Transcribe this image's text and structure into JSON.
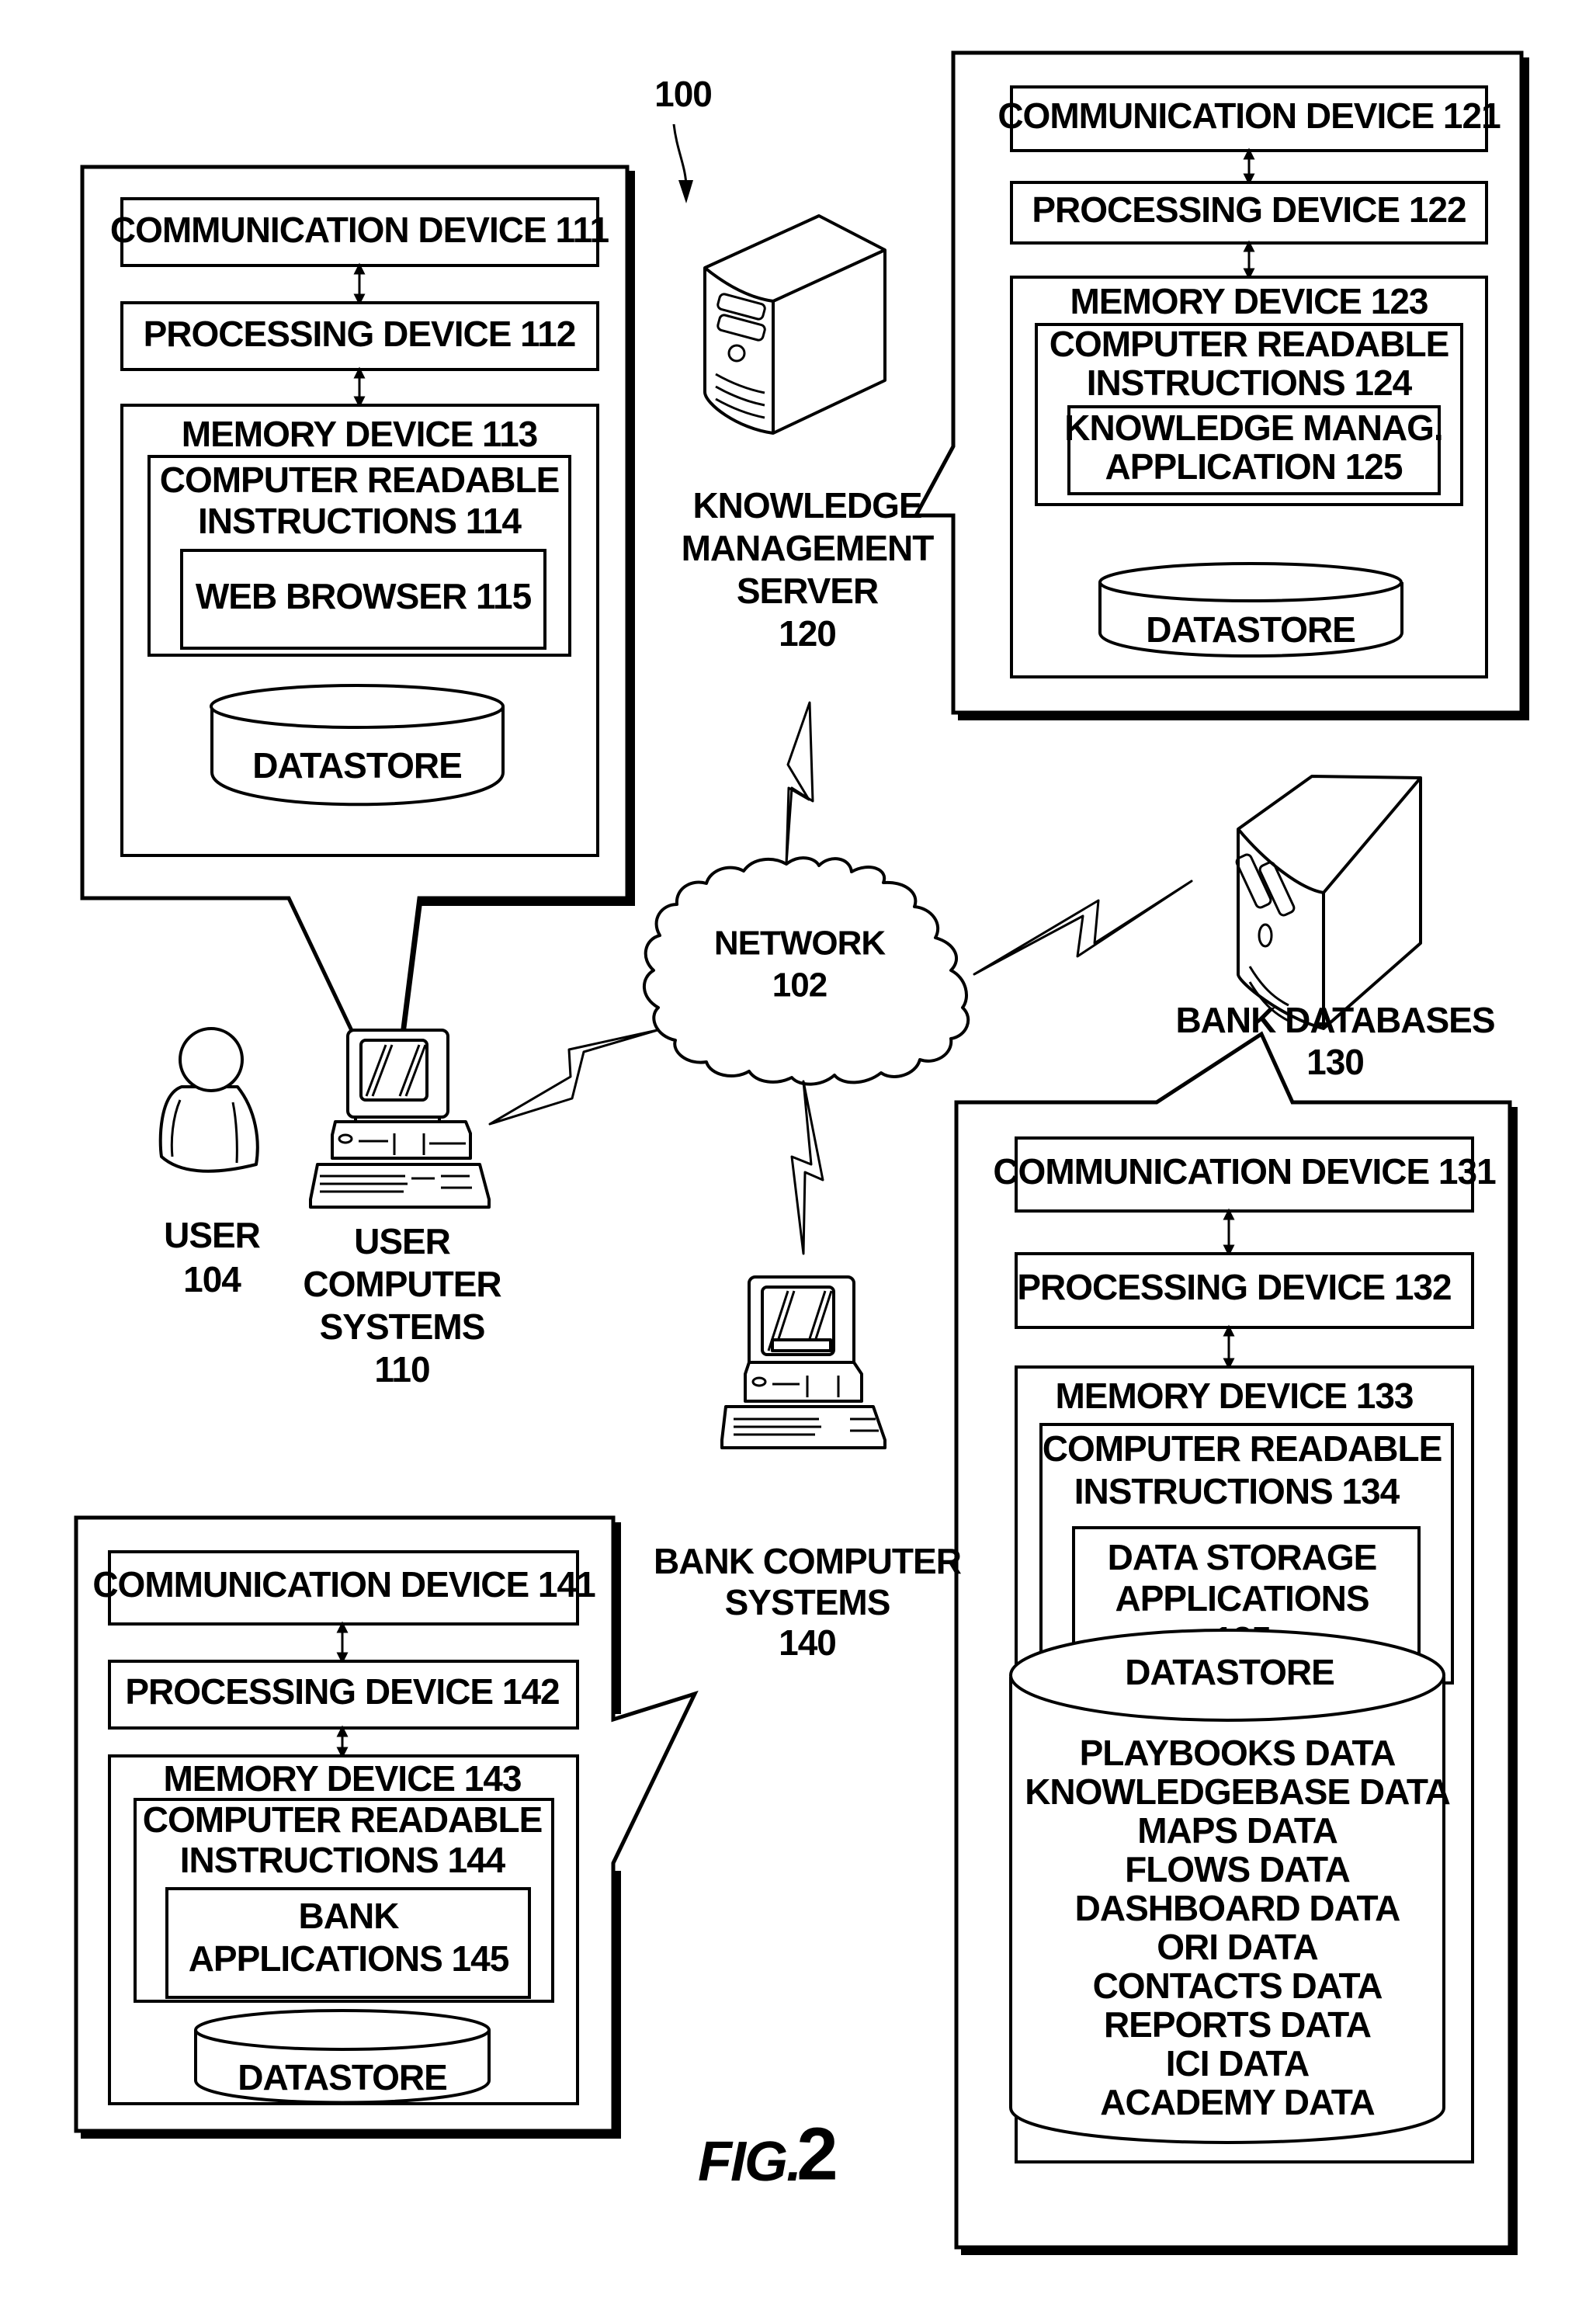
{
  "figure": {
    "reference": "100",
    "caption_prefix": "FIG.",
    "caption_number": "2"
  },
  "user": {
    "lines": [
      "USER",
      "104"
    ],
    "icon": "person-icon"
  },
  "user_computer_systems": {
    "lines": [
      "USER",
      "COMPUTER",
      "SYSTEMS",
      "110"
    ],
    "icon": "desktop-computer-icon",
    "details": {
      "communication": "COMMUNICATION DEVICE 111",
      "processing": "PROCESSING DEVICE 112",
      "memory": "MEMORY DEVICE 113",
      "instructions": [
        "COMPUTER READABLE",
        "INSTRUCTIONS 114"
      ],
      "application": [
        "WEB BROWSER 115"
      ],
      "datastore": "DATASTORE"
    }
  },
  "knowledge_management_server": {
    "lines": [
      "KNOWLEDGE",
      "MANAGEMENT",
      "SERVER",
      "120"
    ],
    "icon": "server-tower-icon",
    "details": {
      "communication": "COMMUNICATION DEVICE 121",
      "processing": "PROCESSING DEVICE 122",
      "memory": "MEMORY DEVICE 123",
      "instructions": [
        "COMPUTER READABLE",
        "INSTRUCTIONS 124"
      ],
      "application": [
        "KNOWLEDGE MANAG.",
        "APPLICATION 125"
      ],
      "datastore": "DATASTORE"
    }
  },
  "network": {
    "lines": [
      "NETWORK",
      "102"
    ],
    "icon": "cloud-icon"
  },
  "bank_databases": {
    "lines": [
      "BANK DATABASES",
      "130"
    ],
    "icon": "server-tower-icon",
    "details": {
      "communication": "COMMUNICATION DEVICE 131",
      "processing": "PROCESSING DEVICE 132",
      "memory": "MEMORY DEVICE 133",
      "instructions": [
        "COMPUTER READABLE",
        "INSTRUCTIONS 134"
      ],
      "application": [
        "DATA STORAGE",
        "APPLICATIONS",
        "135"
      ],
      "datastore": "DATASTORE",
      "datastore_items": [
        "PLAYBOOKS DATA",
        "KNOWLEDGEBASE DATA",
        "MAPS DATA",
        "FLOWS DATA",
        "DASHBOARD DATA",
        "ORI DATA",
        "CONTACTS DATA",
        "REPORTS DATA",
        "ICI DATA",
        "ACADEMY DATA"
      ]
    }
  },
  "bank_computer_systems": {
    "lines": [
      "BANK COMPUTER",
      "SYSTEMS",
      "140"
    ],
    "icon": "desktop-computer-icon",
    "details": {
      "communication": "COMMUNICATION DEVICE 141",
      "processing": "PROCESSING DEVICE 142",
      "memory": "MEMORY DEVICE 143",
      "instructions": [
        "COMPUTER READABLE",
        "INSTRUCTIONS 144"
      ],
      "application": [
        "BANK",
        "APPLICATIONS 145"
      ],
      "datastore": "DATASTORE"
    }
  },
  "connections": [
    {
      "from": "network",
      "to": "knowledge_management_server",
      "type": "wireless"
    },
    {
      "from": "network",
      "to": "bank_databases",
      "type": "wireless"
    },
    {
      "from": "network",
      "to": "user_computer_systems",
      "type": "wireless"
    },
    {
      "from": "network",
      "to": "bank_computer_systems",
      "type": "wireless"
    }
  ]
}
